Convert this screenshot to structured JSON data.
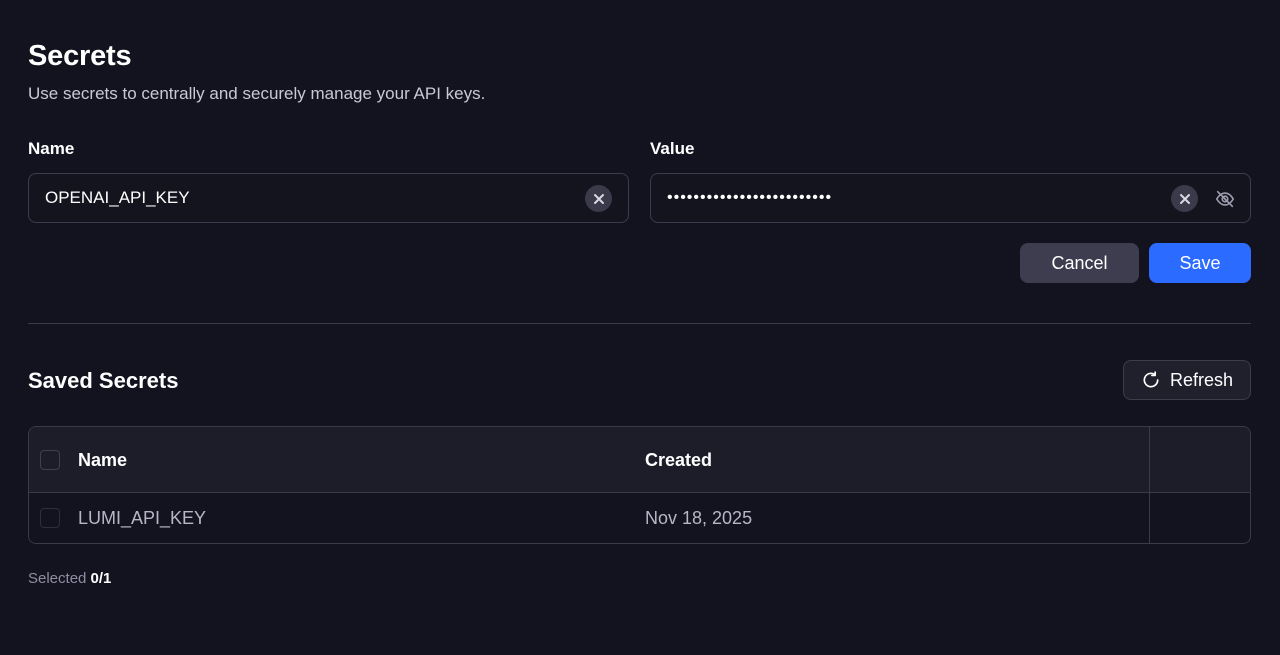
{
  "header": {
    "title": "Secrets",
    "subtitle": "Use secrets to centrally and securely manage your API keys."
  },
  "form": {
    "name_label": "Name",
    "name_value": "OPENAI_API_KEY",
    "value_label": "Value",
    "value_masked": "•••••••••••••••••••••••••",
    "cancel_label": "Cancel",
    "save_label": "Save"
  },
  "saved": {
    "title": "Saved Secrets",
    "refresh_label": "Refresh",
    "columns": [
      "Name",
      "Created"
    ],
    "rows": [
      {
        "name": "LUMI_API_KEY",
        "created": "Nov 18, 2025"
      }
    ],
    "selected_label": "Selected",
    "selected_count": "0/1"
  },
  "colors": {
    "background": "#131320",
    "primary": "#2b6bff",
    "secondary_button": "#3d3d4f"
  },
  "icons": {
    "clear": "close-icon",
    "visibility": "eye-off-icon",
    "refresh": "refresh-icon"
  }
}
